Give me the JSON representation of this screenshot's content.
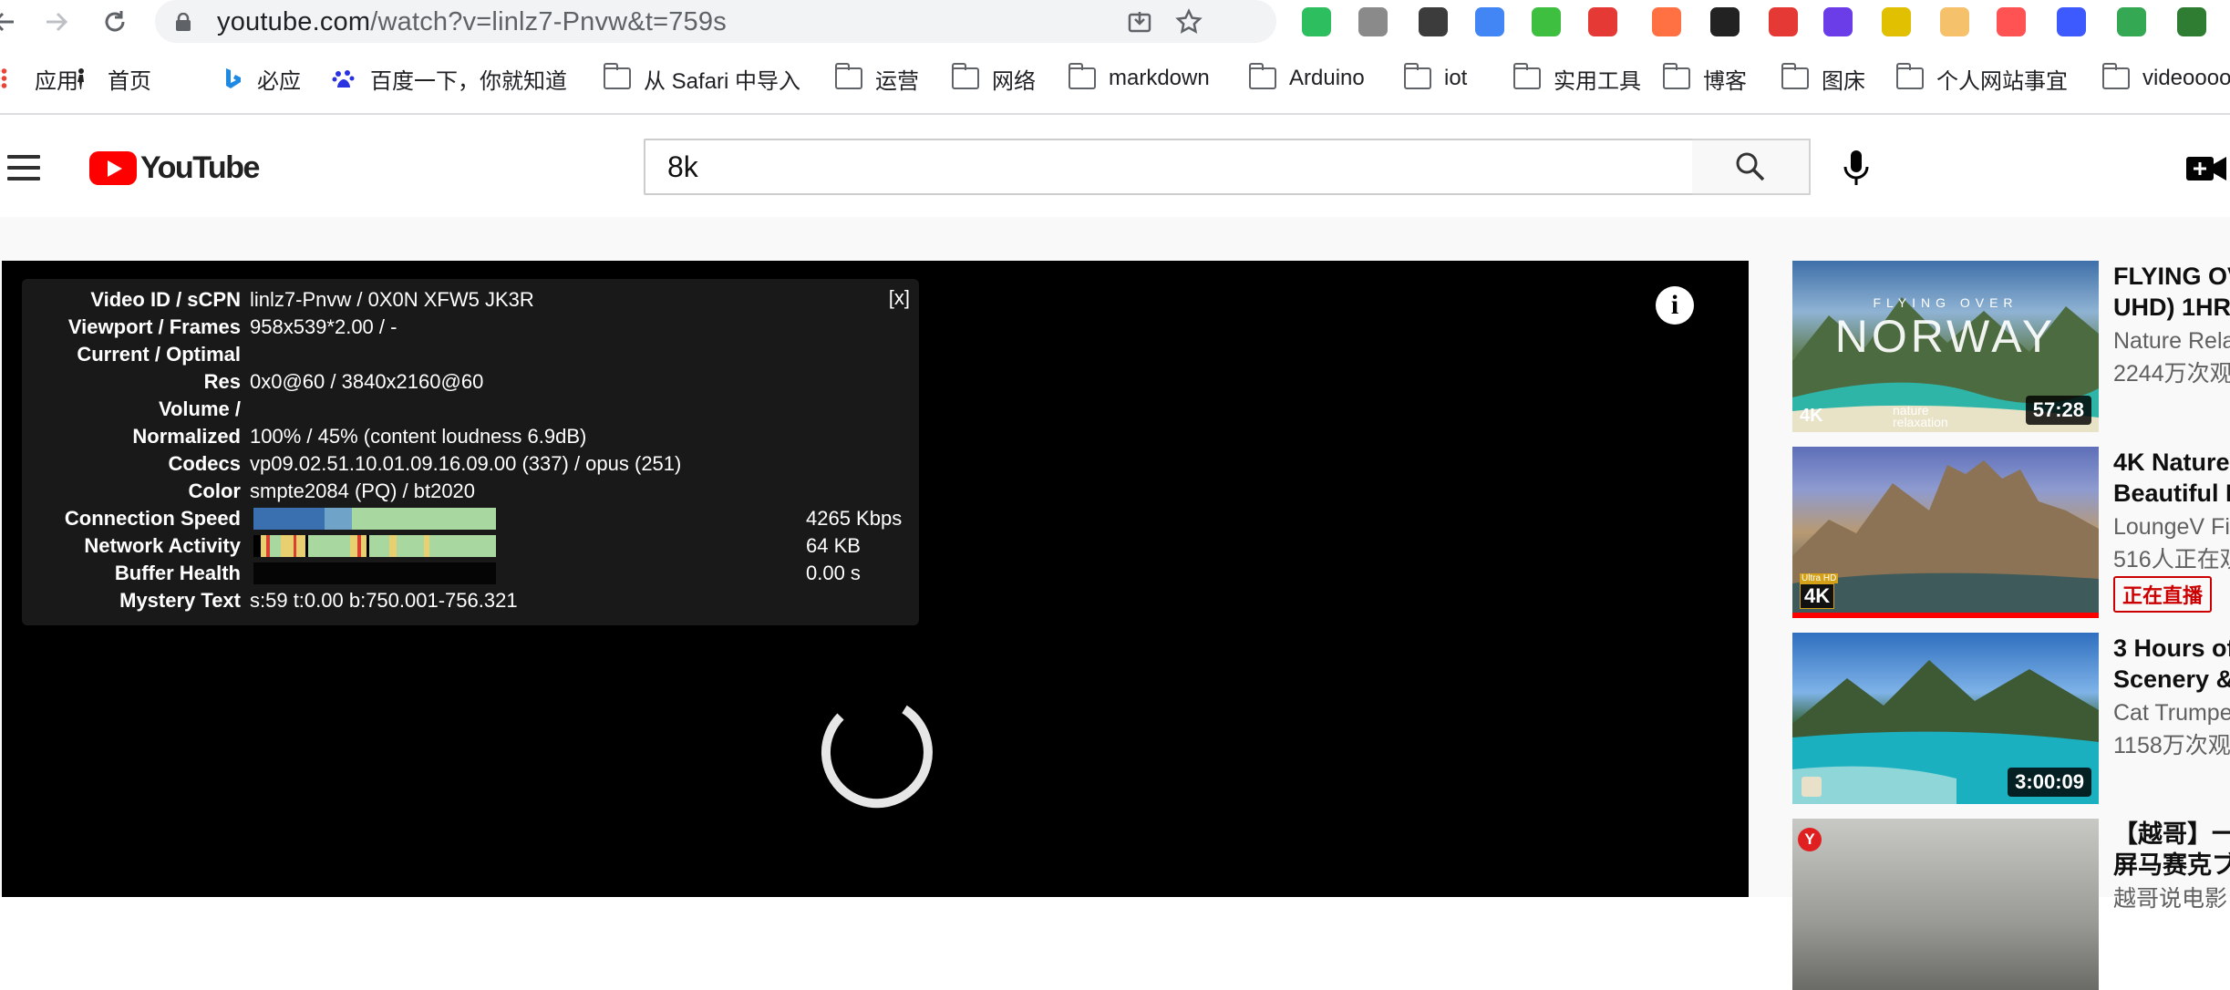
{
  "browser": {
    "url_host": "youtube.com",
    "url_path": "/watch?v=linlz7-Pnvw&t=759s",
    "bookmarks": [
      {
        "label": "应用",
        "icon": "apps-grid-icon"
      },
      {
        "label": "首页",
        "icon": "person-icon"
      },
      {
        "label": "必应",
        "icon": "bing-icon"
      },
      {
        "label": "百度一下，你就知道",
        "icon": "baidu-icon"
      },
      {
        "label": "从 Safari 中导入",
        "icon": "folder-icon"
      },
      {
        "label": "运营",
        "icon": "folder-icon"
      },
      {
        "label": "网络",
        "icon": "folder-icon"
      },
      {
        "label": "markdown",
        "icon": "folder-icon"
      },
      {
        "label": "Arduino",
        "icon": "folder-icon"
      },
      {
        "label": "iot",
        "icon": "folder-icon"
      },
      {
        "label": "实用工具",
        "icon": "folder-icon"
      },
      {
        "label": "博客",
        "icon": "folder-icon"
      },
      {
        "label": "图床",
        "icon": "folder-icon"
      },
      {
        "label": "个人网站事宜",
        "icon": "folder-icon"
      },
      {
        "label": "videoooo",
        "icon": "folder-icon"
      }
    ],
    "extension_colors": [
      "#2dbe60",
      "#8a8a8a",
      "#3c3c3c",
      "#4285f4",
      "#3fbf3f",
      "#e53935",
      "#ff7043",
      "#222222",
      "#e53935",
      "#6a3de8",
      "#e0c000",
      "#f5c26b",
      "#ff5252",
      "#3d5afe",
      "#34a853",
      "#2e7d32"
    ]
  },
  "youtube": {
    "logo_text": "YouTube",
    "search_query": "8k"
  },
  "stats": {
    "close_label": "[x]",
    "rows": [
      {
        "label": "Video ID / sCPN",
        "value": "linlz7-Pnvw / 0X0N XFW5 JK3R"
      },
      {
        "label": "Viewport / Frames",
        "value": "958x539*2.00 / -"
      },
      {
        "label": "Current / Optimal",
        "value": ""
      },
      {
        "label": "Res",
        "value": "0x0@60 / 3840x2160@60"
      },
      {
        "label": "Volume /",
        "value": ""
      },
      {
        "label": "Normalized",
        "value": "100% / 45% (content loudness 6.9dB)"
      },
      {
        "label": "Codecs",
        "value": "vp09.02.51.10.01.09.16.09.00 (337) / opus (251)"
      },
      {
        "label": "Color",
        "value": "smpte2084 (PQ) / bt2020"
      },
      {
        "label": "Connection Speed",
        "value": "4265 Kbps"
      },
      {
        "label": "Network Activity",
        "value": "64 KB"
      },
      {
        "label": "Buffer Health",
        "value": "0.00 s"
      },
      {
        "label": "Mystery Text",
        "value": "s:59 t:0.00 b:750.001-756.321"
      }
    ]
  },
  "sidebar": {
    "videos": [
      {
        "title_line1": "FLYING OV",
        "title_line2": "UHD) 1HR",
        "channel": "Nature Rela",
        "views": "2244万次观",
        "duration": "57:28",
        "thumb_text": "NORWAY",
        "thumb_sub": "FLYING OVER",
        "thumb_badge": "4K",
        "thumb_brand": "nature relaxation"
      },
      {
        "title_line1": "4K Nature",
        "title_line2": "Beautiful F",
        "channel": "LoungeV Fi",
        "views": "516人正在观",
        "badge": "正在直播",
        "thumb_badge": "4K",
        "thumb_badge_top": "Ultra HD"
      },
      {
        "title_line1": "3 Hours of",
        "title_line2": "Scenery &",
        "channel": "Cat Trumpe",
        "views": "1158万次观",
        "duration": "3:00:09"
      },
      {
        "title_line1": "【越哥】一",
        "title_line2": "屏马赛克ブ",
        "channel": "越哥说电影",
        "thumb_badge": "Y"
      }
    ]
  }
}
